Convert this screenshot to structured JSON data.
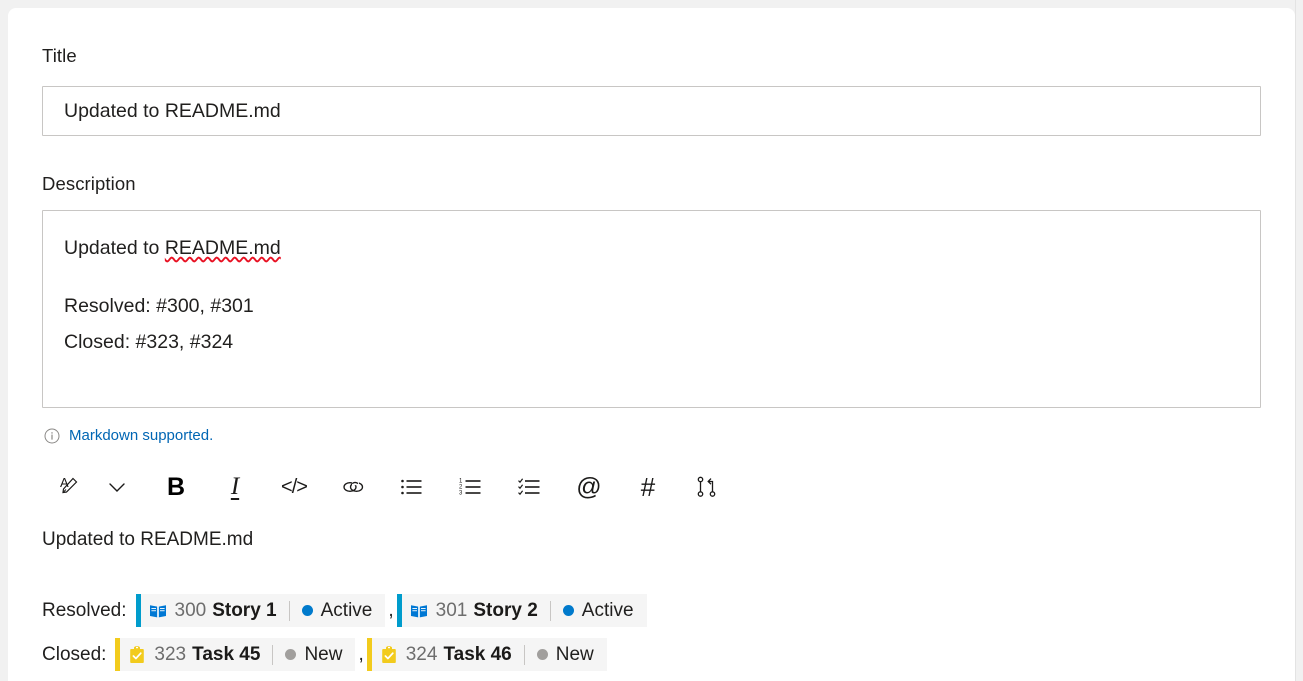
{
  "form": {
    "title_label": "Title",
    "title_value": "Updated to README.md",
    "description_label": "Description",
    "description_line1_prefix": "Updated to ",
    "description_line1_misspelled": "README.md",
    "description_line2": "Resolved: #300, #301",
    "description_line3": "Closed: #323, #324",
    "markdown_note": "Markdown supported.",
    "info_icon": "info-circle-icon"
  },
  "toolbar": {
    "items": [
      {
        "name": "font-color-icon",
        "label": "A",
        "title": "Font color"
      },
      {
        "name": "chevron-down-icon",
        "label": "⌄",
        "title": "More font colors"
      },
      {
        "name": "bold-icon",
        "label": "B",
        "title": "Bold"
      },
      {
        "name": "italic-icon",
        "label": "I",
        "title": "Italic"
      },
      {
        "name": "code-icon",
        "label": "</>",
        "title": "Code"
      },
      {
        "name": "link-icon",
        "label": "⚭",
        "title": "Link"
      },
      {
        "name": "bulleted-list-icon",
        "label": "",
        "title": "Bulleted list"
      },
      {
        "name": "numbered-list-icon",
        "label": "",
        "title": "Numbered list"
      },
      {
        "name": "checklist-icon",
        "label": "",
        "title": "Checklist"
      },
      {
        "name": "mention-icon",
        "label": "@",
        "title": "Mention"
      },
      {
        "name": "hashtag-icon",
        "label": "#",
        "title": "Work item link"
      },
      {
        "name": "pull-request-icon",
        "label": "",
        "title": "Pull request"
      }
    ]
  },
  "preview": {
    "heading": "Updated to README.md",
    "rows": [
      {
        "label": "Resolved:",
        "chips": [
          {
            "id": "300",
            "title": "Story 1",
            "state": "Active",
            "type": "User Story",
            "icon": "book-icon",
            "accent_color": "#009CCC",
            "icon_color": "#0078D4",
            "state_dot_color": "#007ACC"
          },
          {
            "id": "301",
            "title": "Story 2",
            "state": "Active",
            "type": "User Story",
            "icon": "book-icon",
            "accent_color": "#009CCC",
            "icon_color": "#0078D4",
            "state_dot_color": "#007ACC"
          }
        ]
      },
      {
        "label": "Closed:",
        "chips": [
          {
            "id": "323",
            "title": "Task 45",
            "state": "New",
            "type": "Task",
            "icon": "clipboard-check-icon",
            "accent_color": "#F2CB1D",
            "icon_color": "#F2CB1D",
            "state_dot_color": "#A19F9D"
          },
          {
            "id": "324",
            "title": "Task 46",
            "state": "New",
            "type": "Task",
            "icon": "clipboard-check-icon",
            "accent_color": "#F2CB1D",
            "icon_color": "#F2CB1D",
            "state_dot_color": "#A19F9D"
          }
        ]
      }
    ],
    "separator": ","
  },
  "colors": {
    "page_background": "#f1f1f1",
    "card_background": "#ffffff",
    "input_border": "#c8c6c4",
    "link_blue": "#0066b4",
    "chip_background": "#f5f5f5",
    "spellcheck_underline": "#e81123"
  }
}
